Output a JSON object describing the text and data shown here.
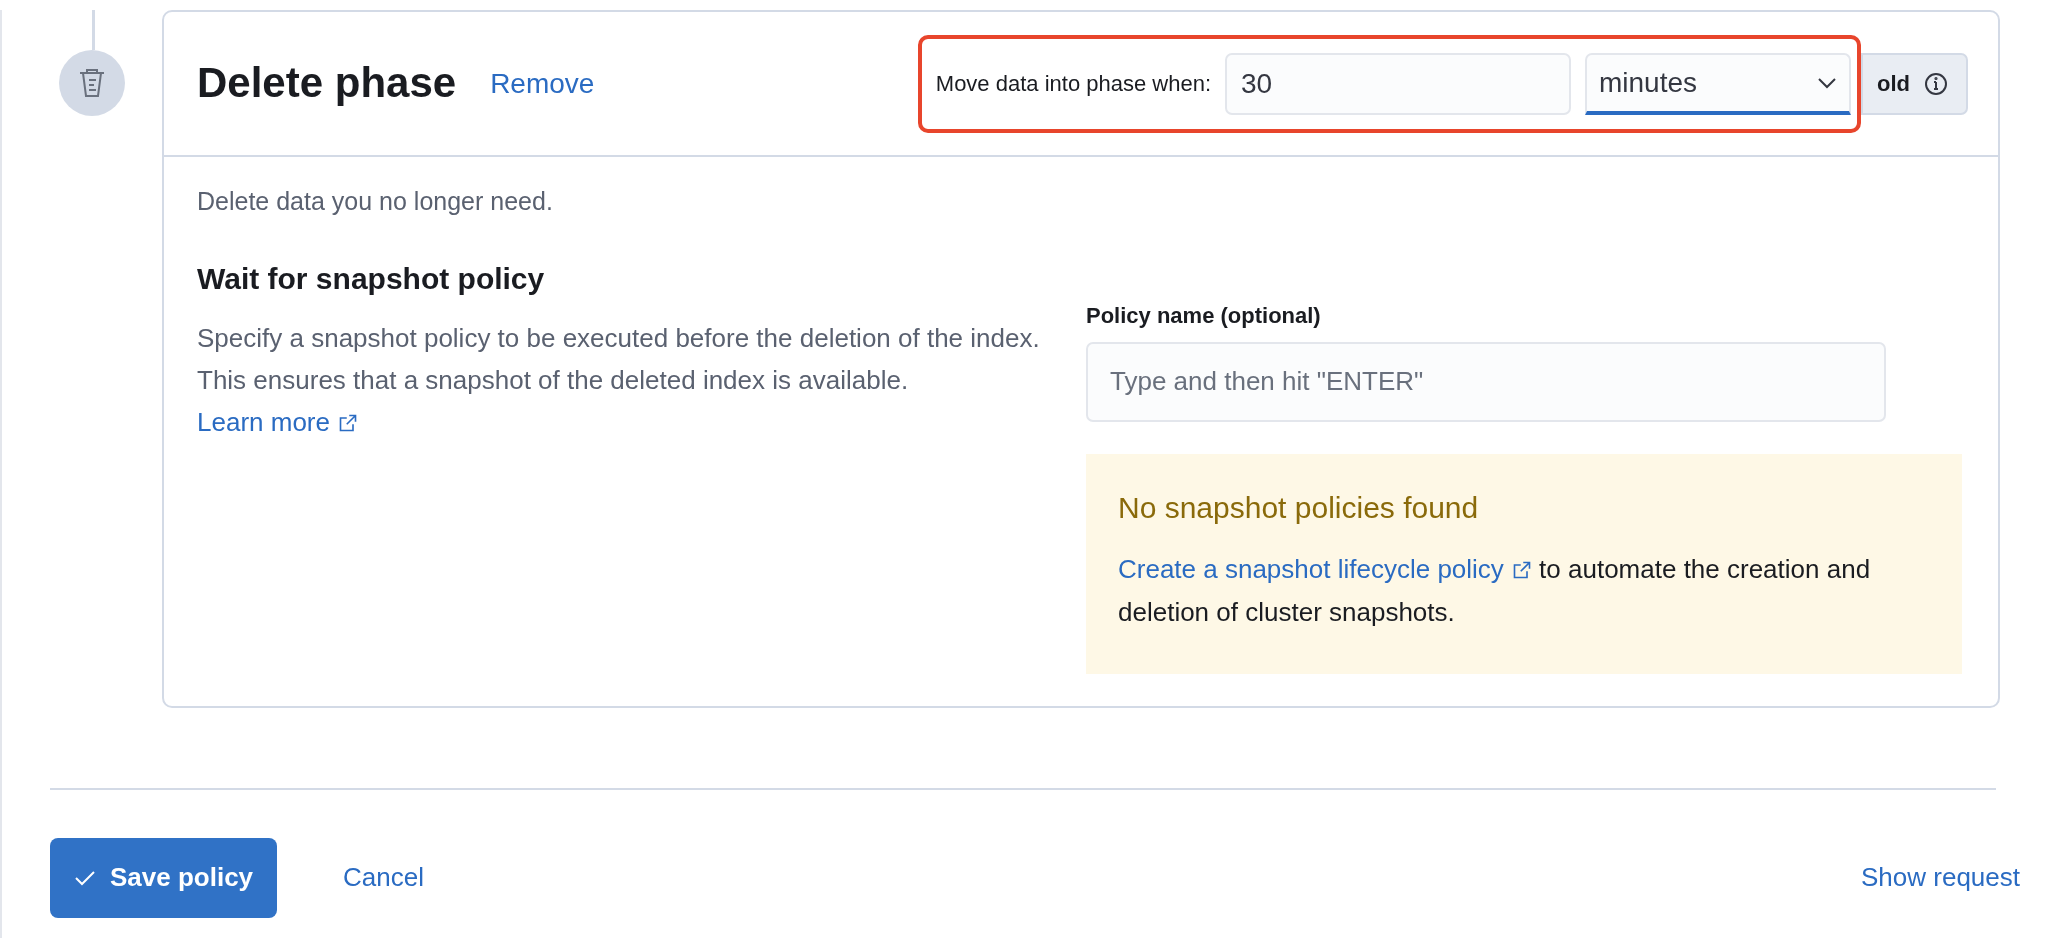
{
  "phase": {
    "title": "Delete phase",
    "remove_link": "Remove",
    "timing": {
      "label": "Move data into phase when:",
      "value": "30",
      "unit": "minutes",
      "append": "old",
      "highlighted": true
    },
    "description": "Delete data you no longer need.",
    "section": {
      "title": "Wait for snapshot policy",
      "text": "Specify a snapshot policy to be executed before the deletion of the index. This ensures that a snapshot of the deleted index is available. ",
      "link": "Learn more"
    },
    "policy_field": {
      "label": "Policy name (optional)",
      "placeholder": "Type and then hit \"ENTER\""
    },
    "callout": {
      "title": "No snapshot policies found",
      "link": "Create a snapshot lifecycle policy",
      "text": " to automate the creation and deletion of cluster snapshots."
    }
  },
  "footer": {
    "save": "Save policy",
    "cancel": "Cancel",
    "show_request": "Show request"
  }
}
